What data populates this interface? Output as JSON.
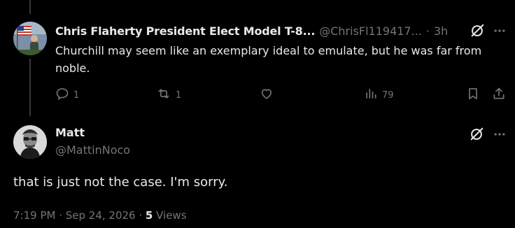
{
  "parent_post": {
    "display_name": "Chris Flaherty President Elect Model T-8...",
    "handle": "@ChrisFl119417...",
    "separator": "·",
    "time": "3h",
    "text": "Churchill may seem like an exemplary ideal to emulate, but he was far from noble.",
    "actions": {
      "reply_count": "1",
      "repost_count": "1",
      "like_count": "",
      "views_count": "79"
    }
  },
  "reply_post": {
    "display_name": "Matt",
    "handle": "@MattinNoco",
    "text": "that is just not the case. I'm sorry.",
    "meta": {
      "timestamp": "7:19 PM · Sep 24, 2026 · ",
      "views_count": "5",
      "views_label": " Views"
    }
  },
  "colors": {
    "background": "#000000",
    "text_primary": "#e7e9ea",
    "text_muted": "#71767b",
    "thread_line": "#333639"
  },
  "icons": [
    "grok-icon",
    "more-icon",
    "reply-icon",
    "repost-icon",
    "like-icon",
    "views-icon",
    "bookmark-icon",
    "share-icon"
  ]
}
